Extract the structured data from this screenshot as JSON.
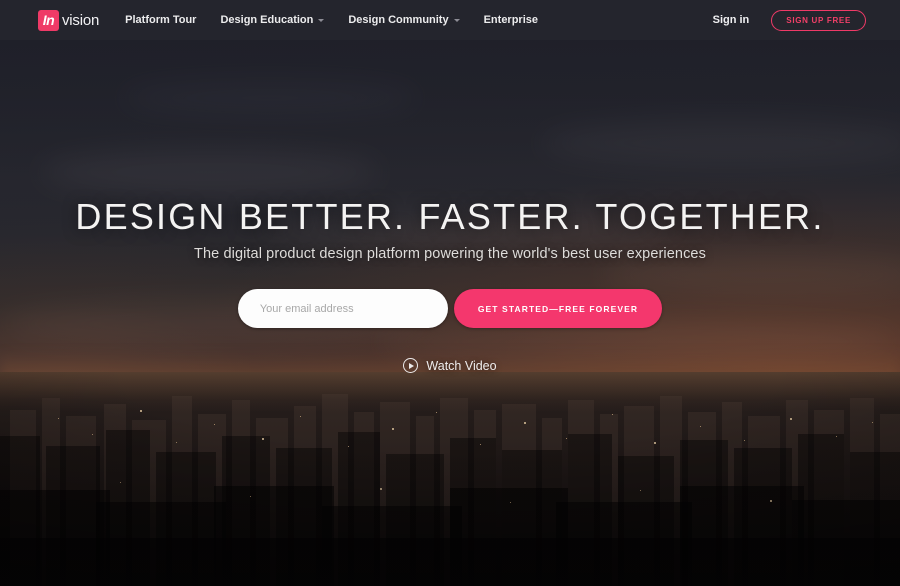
{
  "header": {
    "logo": {
      "mark_text": "In",
      "word_text": "vision",
      "icon": "invision-logo-icon",
      "brand_color": "#ef3a67"
    },
    "nav": [
      {
        "label": "Platform Tour",
        "has_dropdown": false
      },
      {
        "label": "Design Education",
        "has_dropdown": true
      },
      {
        "label": "Design Community",
        "has_dropdown": true
      },
      {
        "label": "Enterprise",
        "has_dropdown": false
      }
    ],
    "sign_in_label": "Sign in",
    "sign_up_label": "SIGN UP FREE"
  },
  "hero": {
    "headline": "DESIGN BETTER. FASTER. TOGETHER.",
    "subhead": "The digital product design platform powering the world's best user experiences",
    "form": {
      "email_placeholder": "Your email address",
      "email_value": "",
      "cta_label": "GET STARTED—FREE FOREVER",
      "cta_color": "#f4376d"
    },
    "watch_video": {
      "label": "Watch Video",
      "icon": "play-circle-icon"
    },
    "background": "dusk city skyline photograph"
  }
}
